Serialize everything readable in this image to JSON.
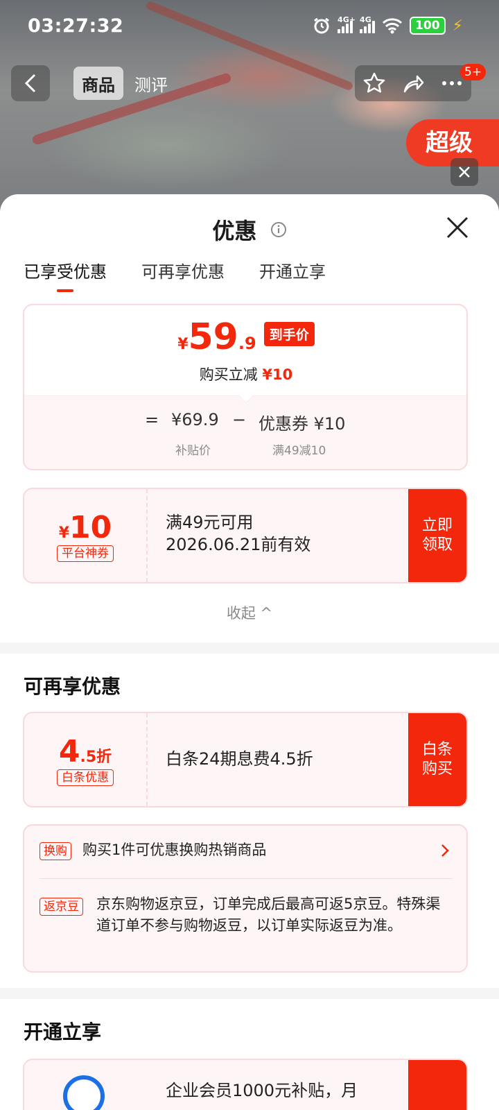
{
  "status_bar": {
    "time": "03:27:32",
    "network1": "4G+",
    "network2": "4G",
    "battery": "100"
  },
  "top_nav": {
    "tabs": [
      "商品",
      "测评"
    ],
    "badge": "5+",
    "promo_ribbon": "超级"
  },
  "sheet": {
    "title": "优惠",
    "tabs": [
      {
        "label": "已享受优惠",
        "active": true
      },
      {
        "label": "可再享优惠",
        "active": false
      },
      {
        "label": "开通立享",
        "active": false
      }
    ],
    "price_card": {
      "currency": "¥",
      "price_int": "59",
      "price_dec": ".9",
      "price_tag": "到手价",
      "discount_text": "购买立减",
      "discount_amount": "¥10",
      "equals": "=",
      "subsidy_price": "¥69.9",
      "minus": "−",
      "coupon_text": "优惠券 ¥10",
      "subsidy_label": "补贴价",
      "coupon_rule": "满49减10"
    },
    "coupon": {
      "currency": "¥",
      "amount": "10",
      "label": "平台神券",
      "rule": "满49元可用",
      "validity": "2026.06.21前有效",
      "action": "立即\n领取"
    },
    "collapse_label": "收起 ^",
    "more_section_title": "可再享优惠",
    "baitiao": {
      "amount": "4",
      "amount_unit": ".5折",
      "label": "白条优惠",
      "desc": "白条24期息费4.5折",
      "action": "白条\n购买"
    },
    "perks": [
      {
        "tag": "换购",
        "text": "购买1件可优惠换购热销商品"
      },
      {
        "tag": "返京豆",
        "text": "京东购物返京豆，订单完成后最高可返5京豆。特殊渠道订单不参与购物返豆，以订单实际返豆为准。"
      }
    ],
    "open_section_title": "开通立享",
    "member_text": "企业会员1000元补贴，月"
  },
  "colors": {
    "accent": "#f2270c",
    "card_bg": "#fef6f6",
    "card_border": "#fbd8db"
  }
}
